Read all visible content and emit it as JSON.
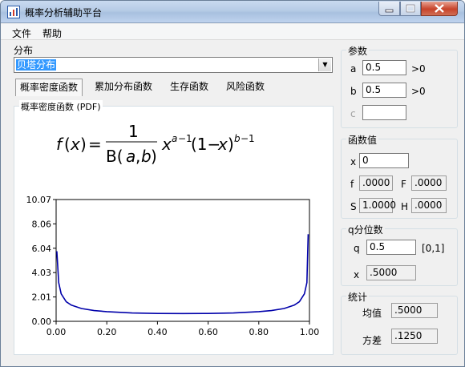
{
  "window": {
    "title": "概率分析辅助平台"
  },
  "menu": {
    "file": "文件",
    "help": "帮助"
  },
  "distribution": {
    "label": "分布",
    "selected": "贝塔分布"
  },
  "tabs": [
    {
      "label": "概率密度函数",
      "active": true
    },
    {
      "label": "累加分布函数",
      "active": false
    },
    {
      "label": "生存函数",
      "active": false
    },
    {
      "label": "风险函数",
      "active": false
    }
  ],
  "pdf_panel": {
    "title": "概率密度函数 (PDF)"
  },
  "params": {
    "title": "参数",
    "a": {
      "label": "a",
      "value": "0.5",
      "constraint": ">0"
    },
    "b": {
      "label": "b",
      "value": "0.5",
      "constraint": ">0"
    },
    "c": {
      "label": "c",
      "value": ""
    }
  },
  "func_values": {
    "title": "函数值",
    "x_label": "x",
    "x_value": "0",
    "f_label": "f",
    "f_value": ".0000",
    "F_label": "F",
    "F_value": ".0000",
    "S_label": "S",
    "S_value": "1.0000",
    "H_label": "H",
    "H_value": ".0000"
  },
  "quantile": {
    "title": "q分位数",
    "q_label": "q",
    "q_value": "0.5",
    "q_range": "[0,1]",
    "x_label": "x",
    "x_value": ".5000"
  },
  "stats": {
    "title": "统计",
    "mean_label": "均值",
    "mean_value": ".5000",
    "var_label": "方差",
    "var_value": ".1250"
  },
  "colors": {
    "curve": "#0000aa",
    "title_bar": "#b6cbe6",
    "selection": "#3399ff"
  },
  "icons": {
    "app": "app-chart-icon",
    "minimize": "minimize-icon",
    "maximize": "maximize-icon",
    "close": "close-icon",
    "dropdown": "chevron-down-icon"
  },
  "chart_data": {
    "type": "line",
    "title": "",
    "xlabel": "",
    "ylabel": "",
    "xlim": [
      0,
      1
    ],
    "ylim": [
      0,
      10.07
    ],
    "xticks": [
      "0.00",
      "0.20",
      "0.40",
      "0.60",
      "0.80",
      "1.00"
    ],
    "yticks": [
      "0.00",
      "2.01",
      "4.03",
      "6.04",
      "8.06",
      "10.07"
    ],
    "grid": false,
    "series": [
      {
        "x": [
          0.003,
          0.01,
          0.02,
          0.04,
          0.06,
          0.1,
          0.15,
          0.2,
          0.3,
          0.4,
          0.5,
          0.6,
          0.7,
          0.8,
          0.85,
          0.9,
          0.94,
          0.96,
          0.98,
          0.99,
          0.995
        ],
        "values": [
          5.8,
          3.2,
          2.27,
          1.62,
          1.34,
          1.06,
          0.89,
          0.8,
          0.69,
          0.65,
          0.64,
          0.65,
          0.69,
          0.8,
          0.89,
          1.06,
          1.34,
          1.62,
          2.27,
          3.2,
          7.2
        ]
      }
    ]
  }
}
